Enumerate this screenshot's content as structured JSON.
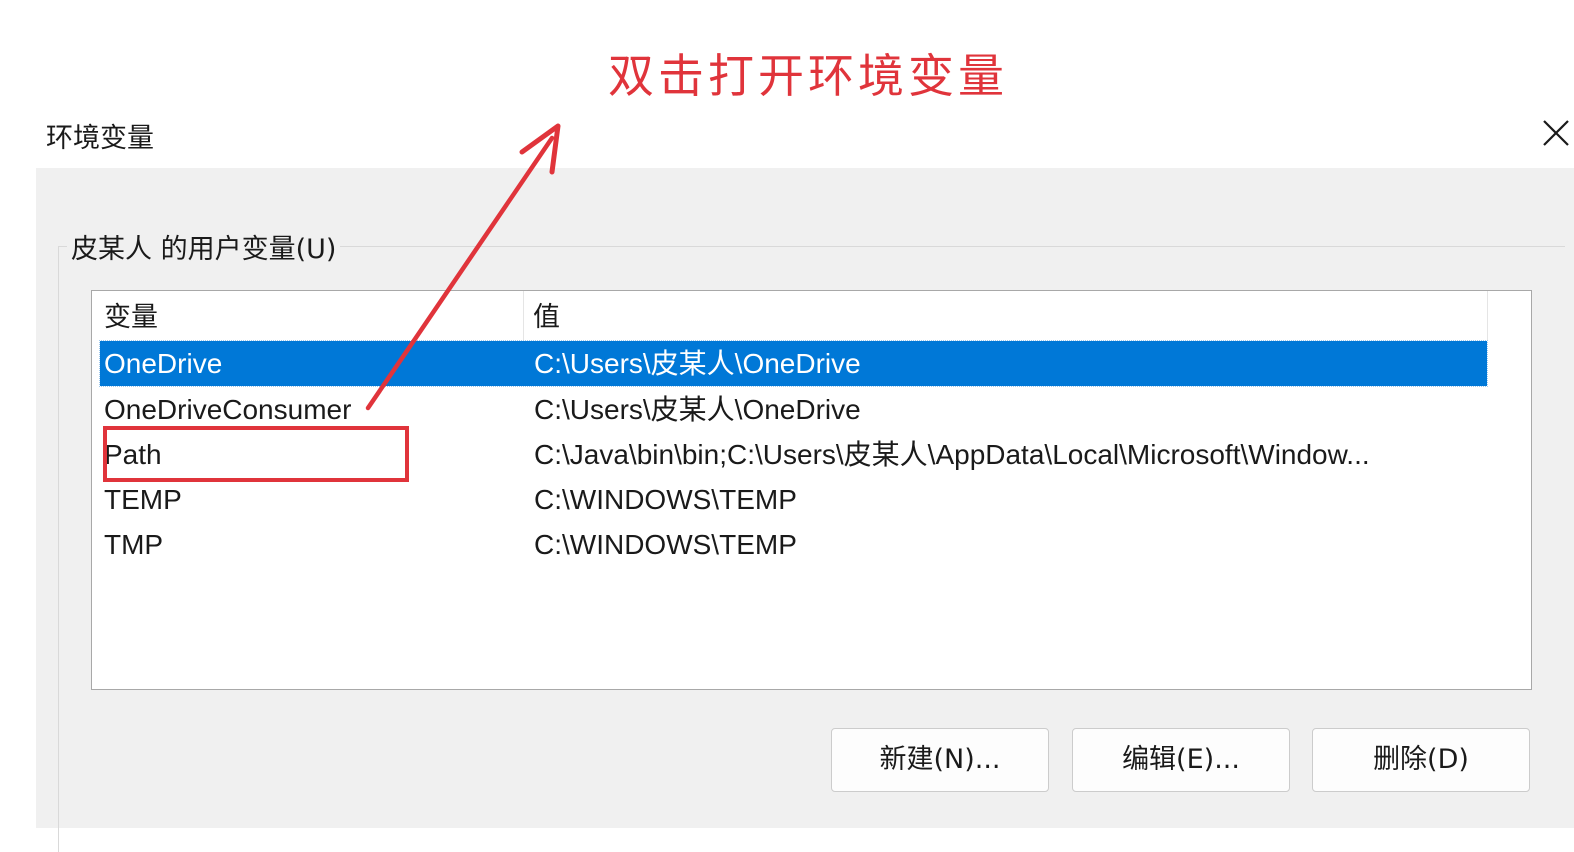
{
  "annotation": {
    "text": "双击打开环境变量",
    "color": "#e0343b"
  },
  "window": {
    "title": "环境变量",
    "close_icon": "close-icon"
  },
  "user_variables": {
    "group_label": "皮某人 的用户变量(U)",
    "columns": {
      "variable": "变量",
      "value": "值"
    },
    "rows": [
      {
        "name": "OneDrive",
        "value": "C:\\Users\\皮某人\\OneDrive",
        "selected": true
      },
      {
        "name": "OneDriveConsumer",
        "value": "C:\\Users\\皮某人\\OneDrive",
        "selected": false
      },
      {
        "name": "Path",
        "value": "C:\\Java\\bin\\bin;C:\\Users\\皮某人\\AppData\\Local\\Microsoft\\Window...",
        "selected": false
      },
      {
        "name": "TEMP",
        "value": "C:\\WINDOWS\\TEMP",
        "selected": false
      },
      {
        "name": "TMP",
        "value": "C:\\WINDOWS\\TEMP",
        "selected": false
      }
    ],
    "buttons": {
      "new": "新建(N)...",
      "edit": "编辑(E)...",
      "delete": "删除(D)"
    }
  },
  "colors": {
    "selection": "#0078d7",
    "annotation": "#e0343b",
    "dialog_background": "#f0f0f0"
  }
}
